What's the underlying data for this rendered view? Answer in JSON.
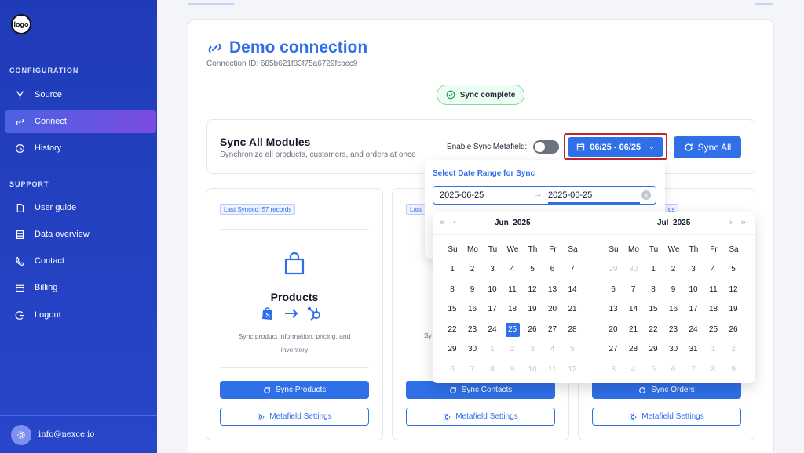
{
  "sidebar": {
    "logo_text": "logo",
    "config_title": "CONFIGURATION",
    "support_title": "SUPPORT",
    "items": [
      {
        "label": "Source"
      },
      {
        "label": "Connect"
      },
      {
        "label": "History"
      },
      {
        "label": "User guide"
      },
      {
        "label": "Data overview"
      },
      {
        "label": "Contact"
      },
      {
        "label": "Billing"
      },
      {
        "label": "Logout"
      }
    ],
    "user_email": "info@nexce.io",
    "active_color": "#5f55e3"
  },
  "header": {
    "title": "Demo connection",
    "connection_id": "Connection ID: 685b621f83f75a6729fcbcc9",
    "status": "Sync complete"
  },
  "sync_panel": {
    "title": "Sync All Modules",
    "subtitle": "Synchronize all products, customers, and orders at once",
    "metafield_label": "Enable Sync Metafield:",
    "date_range_label": "06/25 - 06/25",
    "sync_all_label": "Sync All"
  },
  "modules": [
    {
      "last_synced": "Last Synced: 57 records",
      "title": "Products",
      "description": "Sync product information, pricing, and inventory",
      "sync_label": "Sync Products",
      "settings_label": "Metafield Settings"
    },
    {
      "last_synced": "Last",
      "description_partial": "Sy",
      "sync_label": "Sync Contacts",
      "settings_label": "Metafield Settings"
    },
    {
      "last_synced": "ds",
      "sync_label": "Sync Orders",
      "settings_label": "Metafield Settings"
    }
  ],
  "date_picker": {
    "title": "Select Date Range for Sync",
    "start": "2025-06-25",
    "end": "2025-06-25",
    "left_month": "Jun",
    "left_year": "2025",
    "right_month": "Jul",
    "right_year": "2025",
    "prev_nav": "« ‹",
    "next_nav": "› »",
    "weekdays": [
      "Su",
      "Mo",
      "Tu",
      "We",
      "Th",
      "Fr",
      "Sa"
    ],
    "left_weeks": [
      [
        "1",
        "2",
        "3",
        "4",
        "5",
        "6",
        "7"
      ],
      [
        "8",
        "9",
        "10",
        "11",
        "12",
        "13",
        "14"
      ],
      [
        "15",
        "16",
        "17",
        "18",
        "19",
        "20",
        "21"
      ],
      [
        "22",
        "23",
        "24",
        "25",
        "26",
        "27",
        "28"
      ],
      [
        "29",
        "30",
        "1",
        "2",
        "3",
        "4",
        "5"
      ],
      [
        "6",
        "7",
        "8",
        "9",
        "10",
        "11",
        "12"
      ]
    ],
    "right_weeks": [
      [
        "29",
        "30",
        "1",
        "2",
        "3",
        "4",
        "5"
      ],
      [
        "6",
        "7",
        "8",
        "9",
        "10",
        "11",
        "12"
      ],
      [
        "13",
        "14",
        "15",
        "16",
        "17",
        "18",
        "19"
      ],
      [
        "20",
        "21",
        "22",
        "23",
        "24",
        "25",
        "26"
      ],
      [
        "27",
        "28",
        "29",
        "30",
        "31",
        "1",
        "2"
      ],
      [
        "3",
        "4",
        "5",
        "6",
        "7",
        "8",
        "9"
      ]
    ],
    "selected_day": "25",
    "accent_color": "#2f6fe8"
  }
}
